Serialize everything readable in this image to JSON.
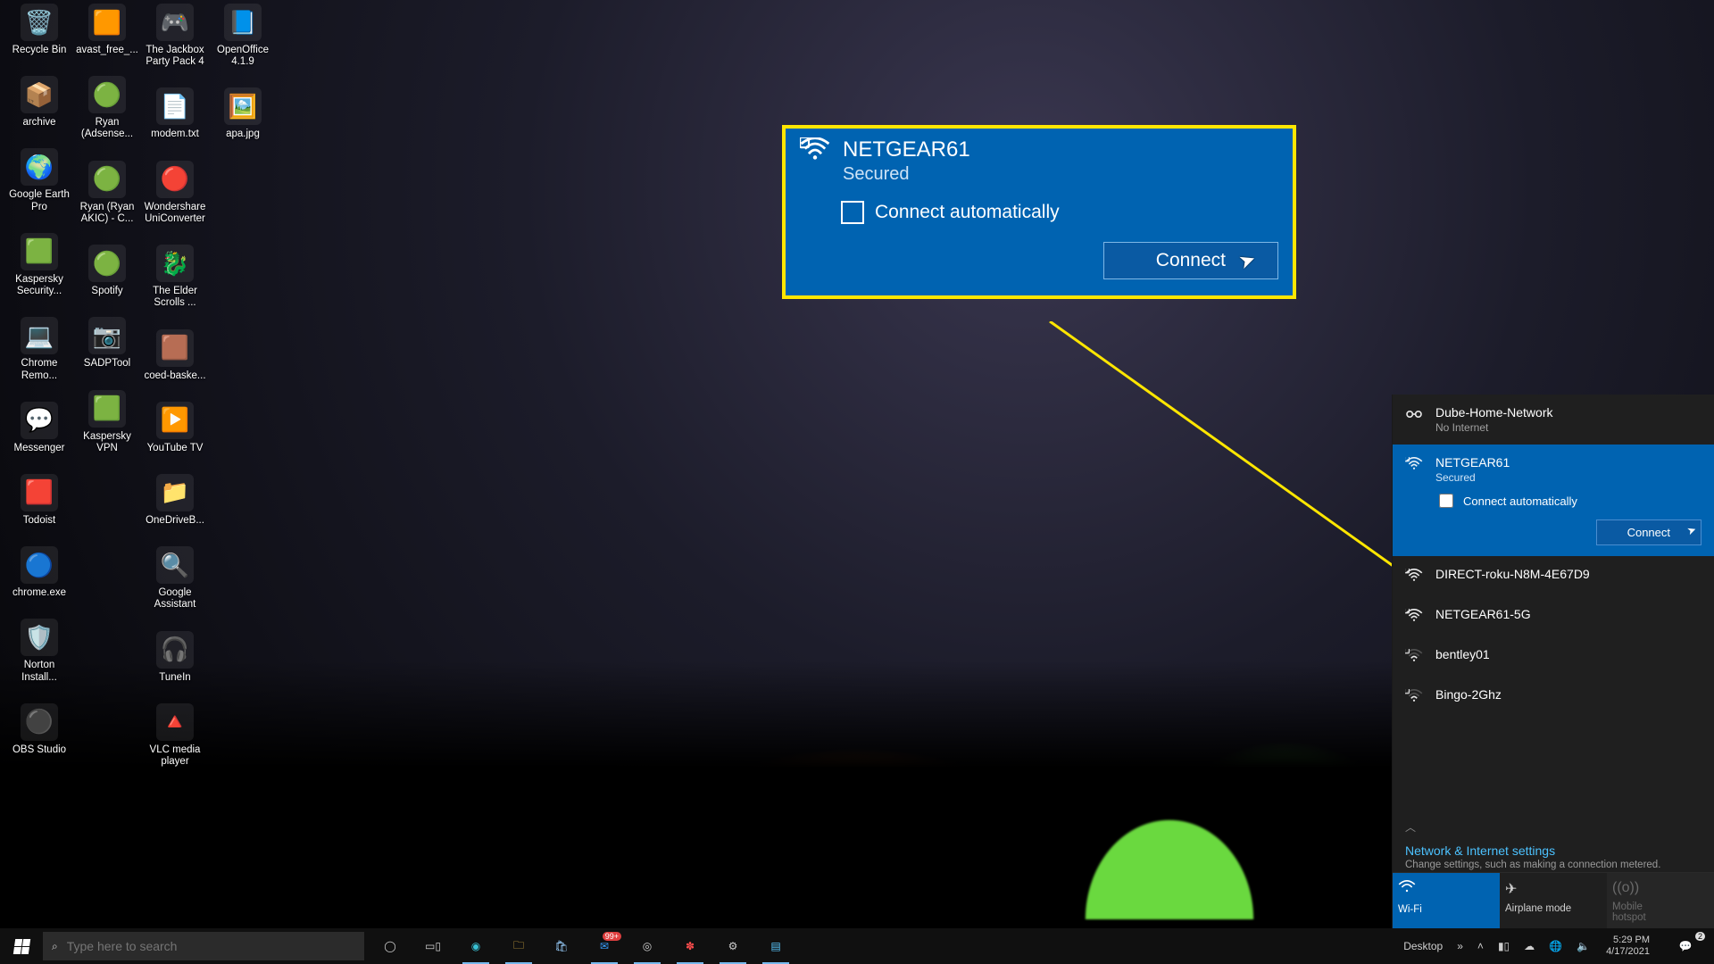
{
  "callout": {
    "ssid": "NETGEAR61",
    "status": "Secured",
    "auto_label": "Connect automatically",
    "connect_label": "Connect"
  },
  "flyout": {
    "networks": [
      {
        "name": "Dube-Home-Network",
        "sub": "No Internet",
        "icon": "link"
      },
      {
        "name": "NETGEAR61",
        "sub": "Secured",
        "icon": "wifi-secure",
        "selected": true
      },
      {
        "name": "DIRECT-roku-N8M-4E67D9",
        "sub": "",
        "icon": "wifi-secure"
      },
      {
        "name": "NETGEAR61-5G",
        "sub": "",
        "icon": "wifi-secure"
      },
      {
        "name": "bentley01",
        "sub": "",
        "icon": "wifi-secure-low"
      },
      {
        "name": "Bingo-2Ghz",
        "sub": "",
        "icon": "wifi-secure-low"
      }
    ],
    "auto_label": "Connect automatically",
    "connect_label": "Connect",
    "settings_link": "Network & Internet settings",
    "settings_sub": "Change settings, such as making a connection metered.",
    "toggles": {
      "wifi": "Wi-Fi",
      "airplane": "Airplane mode",
      "hotspot": "Mobile\nhotspot"
    }
  },
  "desktop_icons": [
    [
      "Recycle Bin",
      "avast_free_...",
      "The Jackbox\nParty Pack 4",
      "OpenOffice\n4.1.9"
    ],
    [
      "archive",
      "",
      "modem.txt",
      ""
    ],
    [
      "Google Earth\nPro",
      "Ryan\n(Adsense...",
      "Wondershare\nUniConverter",
      ""
    ],
    [
      "Kaspersky\nSecurity...",
      "Ryan (Ryan\nAKIC) - C...",
      "The Elder\nScrolls ...",
      ""
    ],
    [
      "Chrome\nRemo...",
      "Spotify",
      "coed-baske...",
      ""
    ],
    [
      "Messenger",
      "SADPTool",
      "YouTube TV",
      "apa.jpg"
    ],
    [
      "Todoist",
      "",
      "OneDriveB...",
      ""
    ],
    [
      "chrome.exe",
      "",
      "Google\nAssistant",
      ""
    ],
    [
      "Norton\nInstall...",
      "",
      "TuneIn",
      ""
    ],
    [
      "OBS Studio",
      "Kaspersky\nVPN",
      "VLC media\nplayer",
      ""
    ]
  ],
  "taskbar": {
    "search_placeholder": "Type here to search",
    "badge99": "99+",
    "desktop_label": "Desktop",
    "time": "5:29 PM",
    "date": "4/17/2021",
    "action_badge": "2"
  }
}
